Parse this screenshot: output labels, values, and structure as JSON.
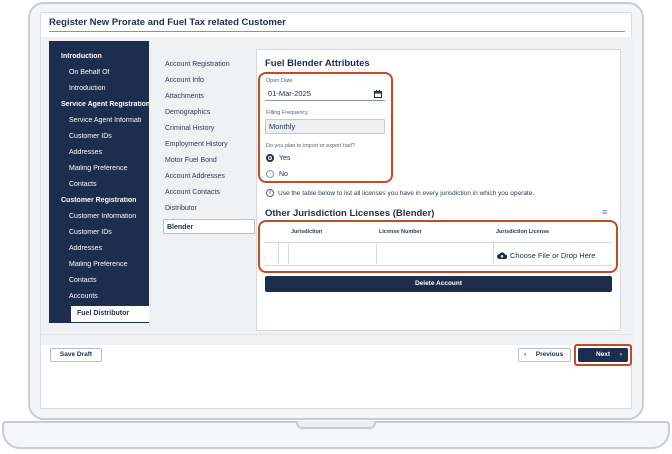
{
  "app": {
    "title": "Register New Prorate and Fuel Tax related Customer"
  },
  "sidebar": {
    "sections": [
      {
        "heading": "Introduction",
        "items": [
          "On Behalf Of",
          "Introduction"
        ]
      },
      {
        "heading": "Service Agent Registration",
        "items": [
          "Service Agent Informati",
          "Customer IDs",
          "Addresses",
          "Mailing Preference",
          "Contacts"
        ]
      },
      {
        "heading": "Customer Registration",
        "items": [
          "Customer Information",
          "Customer IDs",
          "Addresses",
          "Mailing Preference",
          "Contacts",
          "Accounts"
        ]
      }
    ],
    "active_item": "Fuel Distributor"
  },
  "steps": {
    "items": [
      "Account Registration",
      "Account Info",
      "Attachments",
      "Demographics",
      "Criminal History",
      "Employment History",
      "Motor Fuel Bond",
      "Account Addresses",
      "Account Contacts",
      "Distributor"
    ],
    "active": "Blender"
  },
  "form": {
    "title": "Fuel Blender Attributes",
    "open_date_label": "Open Date",
    "open_date_value": "01-Mar-2025",
    "filing_label": "Filling Frequency",
    "filing_value": "Monthly",
    "question": "Do you plan to import or export fuel?",
    "yes_label": "Yes",
    "no_label": "No",
    "selected": "Yes"
  },
  "licenses": {
    "info": "Use the table below to list all licenses you have in every jurisdiction in which you operate.",
    "title": "Other Jurisdiction Licenses (Blender)",
    "columns": [
      "Jurisdiction",
      "License Number",
      "Jurisdiction License"
    ],
    "upload_label": "Choose File or Drop Here"
  },
  "actions": {
    "delete": "Delete Account",
    "save_draft": "Save Draft",
    "previous": "Previous",
    "next": "Next"
  },
  "colors": {
    "navy": "#1c2d4e",
    "highlight": "#c44a25"
  },
  "icons": [
    "calendar-icon",
    "info-icon",
    "filter-icon",
    "cloud-upload-icon",
    "chevron-left-icon",
    "chevron-right-icon"
  ]
}
